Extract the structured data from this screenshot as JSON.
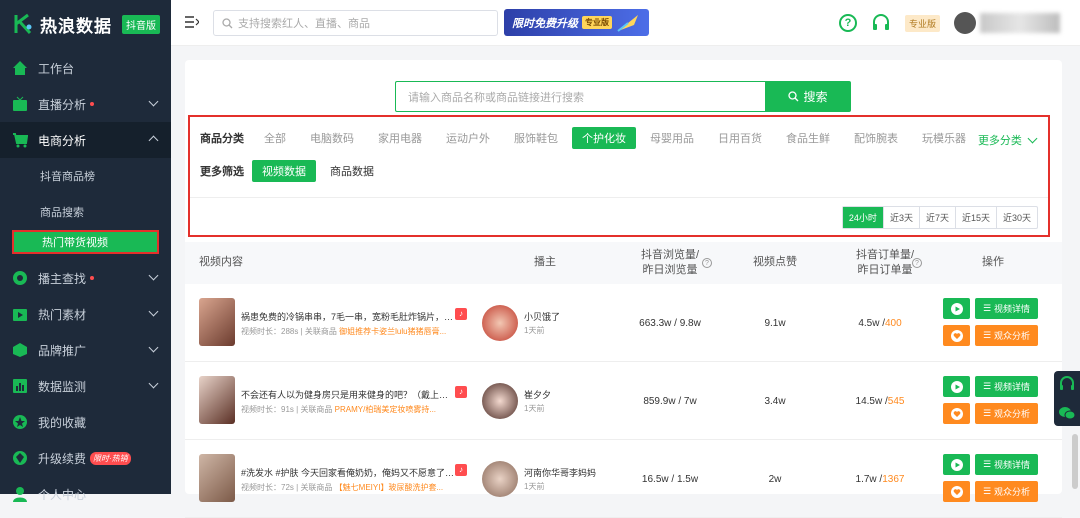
{
  "brand": {
    "name": "热浪数据",
    "badge": "抖音版"
  },
  "sidebar": {
    "items": [
      {
        "label": "工作台"
      },
      {
        "label": "直播分析"
      },
      {
        "label": "电商分析"
      },
      {
        "label": "抖音商品榜"
      },
      {
        "label": "商品搜索"
      },
      {
        "label": "热门带货视频"
      },
      {
        "label": "播主查找"
      },
      {
        "label": "热门素材"
      },
      {
        "label": "品牌推广"
      },
      {
        "label": "数据监测"
      },
      {
        "label": "我的收藏"
      },
      {
        "label": "升级续费"
      },
      {
        "label": "个人中心"
      }
    ],
    "promo_tag": "限时·热销"
  },
  "topbar": {
    "search_placeholder": "支持搜索红人、直播、商品",
    "banner_text": "限时免费升级",
    "banner_tag": "专业版",
    "plan_badge": "专业版"
  },
  "search": {
    "placeholder": "请输入商品名称或商品链接进行搜索",
    "button": "搜索"
  },
  "filters": {
    "category_label": "商品分类",
    "categories": [
      "全部",
      "电脑数码",
      "家用电器",
      "运动户外",
      "服饰鞋包",
      "个护化妆",
      "母婴用品",
      "日用百货",
      "食品生鲜",
      "配饰腕表",
      "玩模乐器"
    ],
    "more_categories": "更多分类",
    "more_label": "更多筛选",
    "more_options": [
      "视频数据",
      "商品数据"
    ],
    "time_ranges": [
      "24小时",
      "近3天",
      "近7天",
      "近15天",
      "近30天"
    ]
  },
  "table": {
    "headers": {
      "video": "视频内容",
      "anchor": "播主",
      "views_a": "抖音浏览量/",
      "views_b": "昨日浏览量",
      "likes": "视频点赞",
      "orders_a": "抖音订单量/",
      "orders_b": "昨日订单量",
      "ops": "操作"
    },
    "rows": [
      {
        "title": "祸患免费的冷锅串串，7毛一串，宽粉毛肚炸锅片，go...",
        "meta_duration": "视频时长：288s",
        "meta_prod_label": "关联商品",
        "meta_prod": "御姐推荐卡姿兰lulu猪猪唇膏...",
        "anchor": "小贝饿了",
        "anchor_time": "1天前",
        "views": "663.3w / 9.8w",
        "likes": "9.1w",
        "orders_total": "4.5w / ",
        "orders_yest": "400"
      },
      {
        "title": "不会还有人以为健身房只是用来健身的吧？（戴上耳机...",
        "meta_duration": "视频时长：91s",
        "meta_prod_label": "关联商品",
        "meta_prod": "PRAMY/柏瑞美定妆喷雾持...",
        "anchor": "崔夕夕",
        "anchor_time": "1天前",
        "views": "859.9w / 7w",
        "likes": "3.4w",
        "orders_total": "14.5w / ",
        "orders_yest": "545"
      },
      {
        "title": "#洗发水 #护肤 今天回家看俺奶奶，俺妈又不愿意了！...",
        "meta_duration": "视频时长：72s",
        "meta_prod_label": "关联商品",
        "meta_prod": "【魅七MEIYI】玻尿酸洗护套...",
        "anchor": "河南你华哥李妈妈",
        "anchor_time": "1天前",
        "views": "16.5w / 1.5w",
        "likes": "2w",
        "orders_total": "1.7w / ",
        "orders_yest": "1367"
      }
    ],
    "btn_video": "视频详情",
    "btn_audience": "观众分析"
  }
}
